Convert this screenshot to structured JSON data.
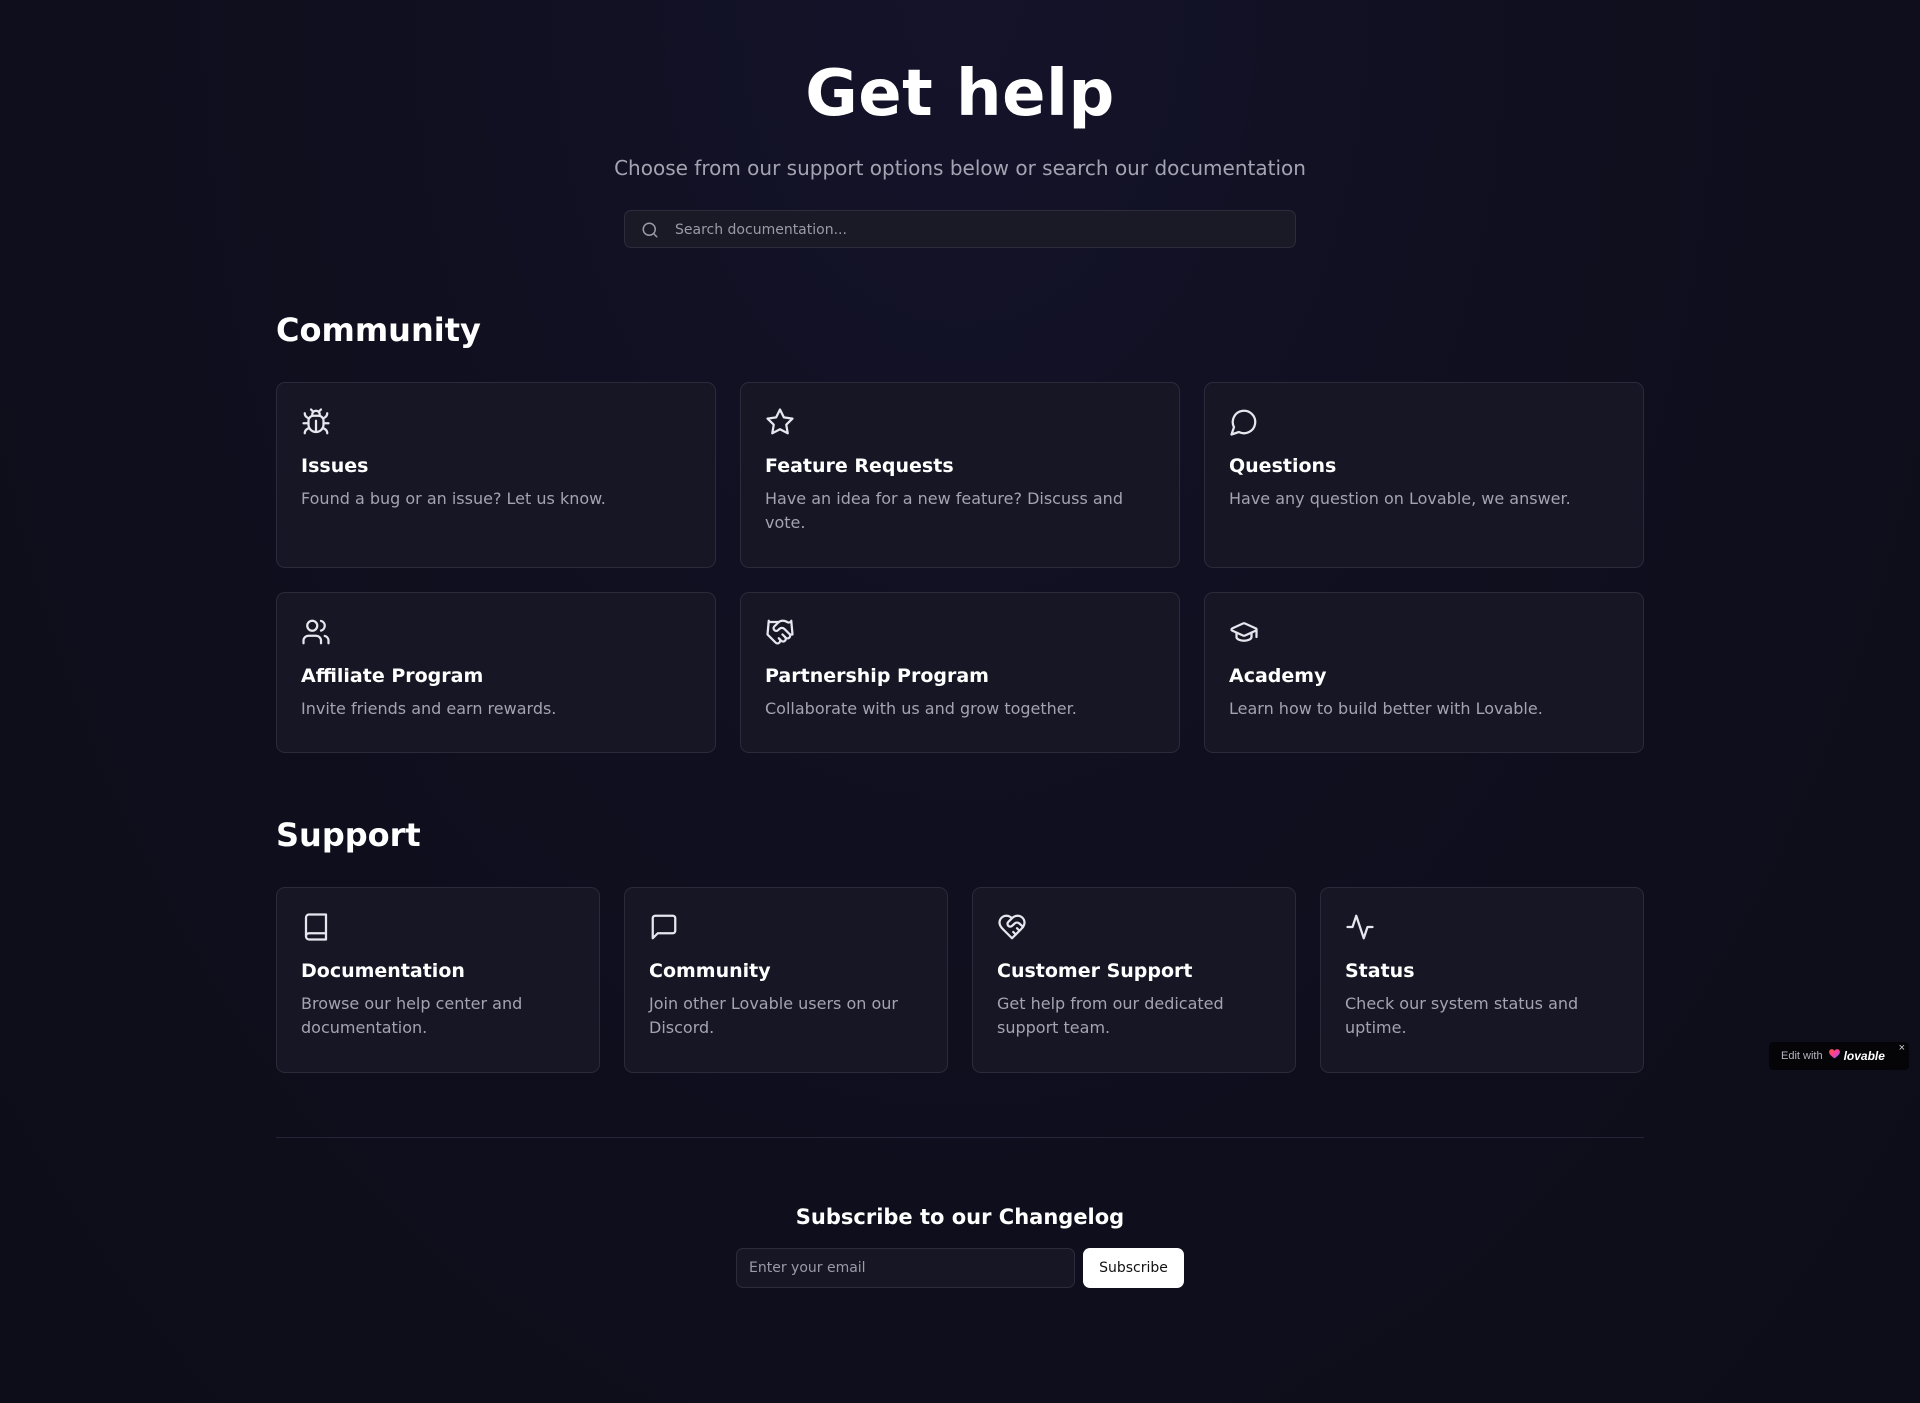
{
  "hero": {
    "title": "Get help",
    "subtitle": "Choose from our support options below or search our documentation"
  },
  "search": {
    "placeholder": "Search documentation...",
    "value": ""
  },
  "community": {
    "title": "Community",
    "cards": [
      {
        "icon": "bug-icon",
        "title": "Issues",
        "description": "Found a bug or an issue? Let us know."
      },
      {
        "icon": "star-icon",
        "title": "Feature Requests",
        "description": "Have an idea for a new feature? Discuss and vote."
      },
      {
        "icon": "message-circle-icon",
        "title": "Questions",
        "description": "Have any question on Lovable, we answer."
      },
      {
        "icon": "users-icon",
        "title": "Affiliate Program",
        "description": "Invite friends and earn rewards."
      },
      {
        "icon": "handshake-icon",
        "title": "Partnership Program",
        "description": "Collaborate with us and grow together."
      },
      {
        "icon": "graduation-cap-icon",
        "title": "Academy",
        "description": "Learn how to build better with Lovable."
      }
    ]
  },
  "support": {
    "title": "Support",
    "cards": [
      {
        "icon": "book-icon",
        "title": "Documentation",
        "description": "Browse our help center and documentation."
      },
      {
        "icon": "message-square-icon",
        "title": "Community",
        "description": "Join other Lovable users on our Discord."
      },
      {
        "icon": "heart-handshake-icon",
        "title": "Customer Support",
        "description": "Get help from our dedicated support team."
      },
      {
        "icon": "activity-icon",
        "title": "Status",
        "description": "Check our system status and uptime."
      }
    ]
  },
  "subscribe": {
    "title": "Subscribe to our Changelog",
    "email_placeholder": "Enter your email",
    "email_value": "",
    "button_label": "Subscribe"
  },
  "badge": {
    "prefix": "Edit with",
    "brand": "lovable",
    "close": "×"
  },
  "colors": {
    "background": "#100f1f",
    "card_background": "#171624",
    "card_border": "#2a2a3a",
    "muted_text": "#a3a3b1",
    "text": "#ffffff",
    "button_background": "#ffffff"
  }
}
